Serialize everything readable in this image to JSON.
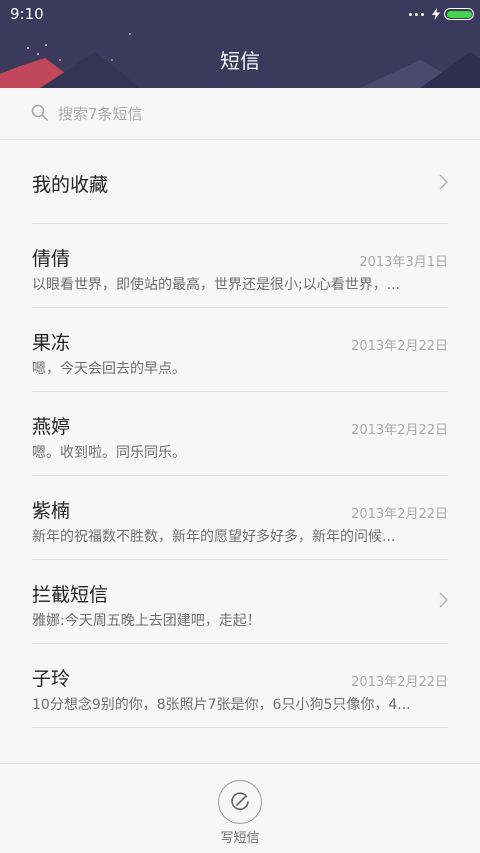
{
  "status_bar": {
    "time": "9:10"
  },
  "header": {
    "title": "短信"
  },
  "search": {
    "placeholder": "搜索7条短信",
    "icon": "search-icon"
  },
  "favorites": {
    "label": "我的收藏"
  },
  "conversations": [
    {
      "name": "倩倩",
      "date": "2013年3月1日",
      "snippet": "以眼看世界，即使站的最高，世界还是很小;以心看世界，..."
    },
    {
      "name": "果冻",
      "date": "2013年2月22日",
      "snippet": "嗯，今天会回去的早点。"
    },
    {
      "name": "燕婷",
      "date": "2013年2月22日",
      "snippet": "嗯。收到啦。同乐同乐。"
    },
    {
      "name": "紫楠",
      "date": "2013年2月22日",
      "snippet": "新年的祝福数不胜数，新年的愿望好多好多，新年的问候..."
    },
    {
      "name": "拦截短信",
      "date": "",
      "snippet": "雅娜:今天周五晚上去团建吧，走起！"
    },
    {
      "name": "子玲",
      "date": "2013年2月22日",
      "snippet": "10分想念9别的你，8张照片7张是你，6只小狗5只像你，4..."
    }
  ],
  "compose": {
    "label": "写短信",
    "icon": "compose-icon"
  },
  "colors": {
    "header_bg": "#3b3a5c",
    "battery": "#45d14a",
    "accent_mountain": "#c0485a"
  }
}
